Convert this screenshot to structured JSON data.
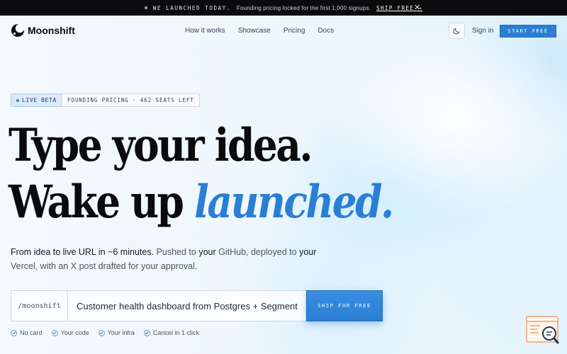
{
  "announcement": {
    "launched_text": "WE LAUNCHED TODAY.",
    "message": "Founding pricing locked for the first 1,000 signups.",
    "cta": "SHIP FREE →",
    "close_glyph": "✕"
  },
  "nav": {
    "brand": "Moonshift",
    "links": [
      "How it works",
      "Showcase",
      "Pricing",
      "Docs"
    ],
    "theme_toggle_icon": "moon-icon",
    "sign_in": "Sign in",
    "start_button": "START FREE"
  },
  "hero": {
    "badge_live": "LIVE BETA",
    "badge_seats": "FOUNDING PRICING · 462 SEATS LEFT",
    "headline_line1": "Type your idea.",
    "headline_line2_plain": "Wake up ",
    "headline_line2_accent": "launched.",
    "sub_part1": "From idea to live URL in ~6 minutes.",
    "sub_part2": " Pushed to ",
    "sub_part3": "your",
    "sub_part4": " GitHub, deployed to ",
    "sub_part5": "your",
    "sub_part6": " Vercel, with an X post drafted for your approval.",
    "input_prefix": "/moonshift",
    "input_value": "Customer health dashboard from Postgres + Segment",
    "ship_button": "SHIP FOR FREE",
    "checks": [
      "No card",
      "Your code",
      "Your infra",
      "Cancel in 1 click"
    ]
  },
  "colors": {
    "accent": "#2a7fd4",
    "announce_bg": "#0b0b0d",
    "text_dark": "#0b0b0d"
  }
}
